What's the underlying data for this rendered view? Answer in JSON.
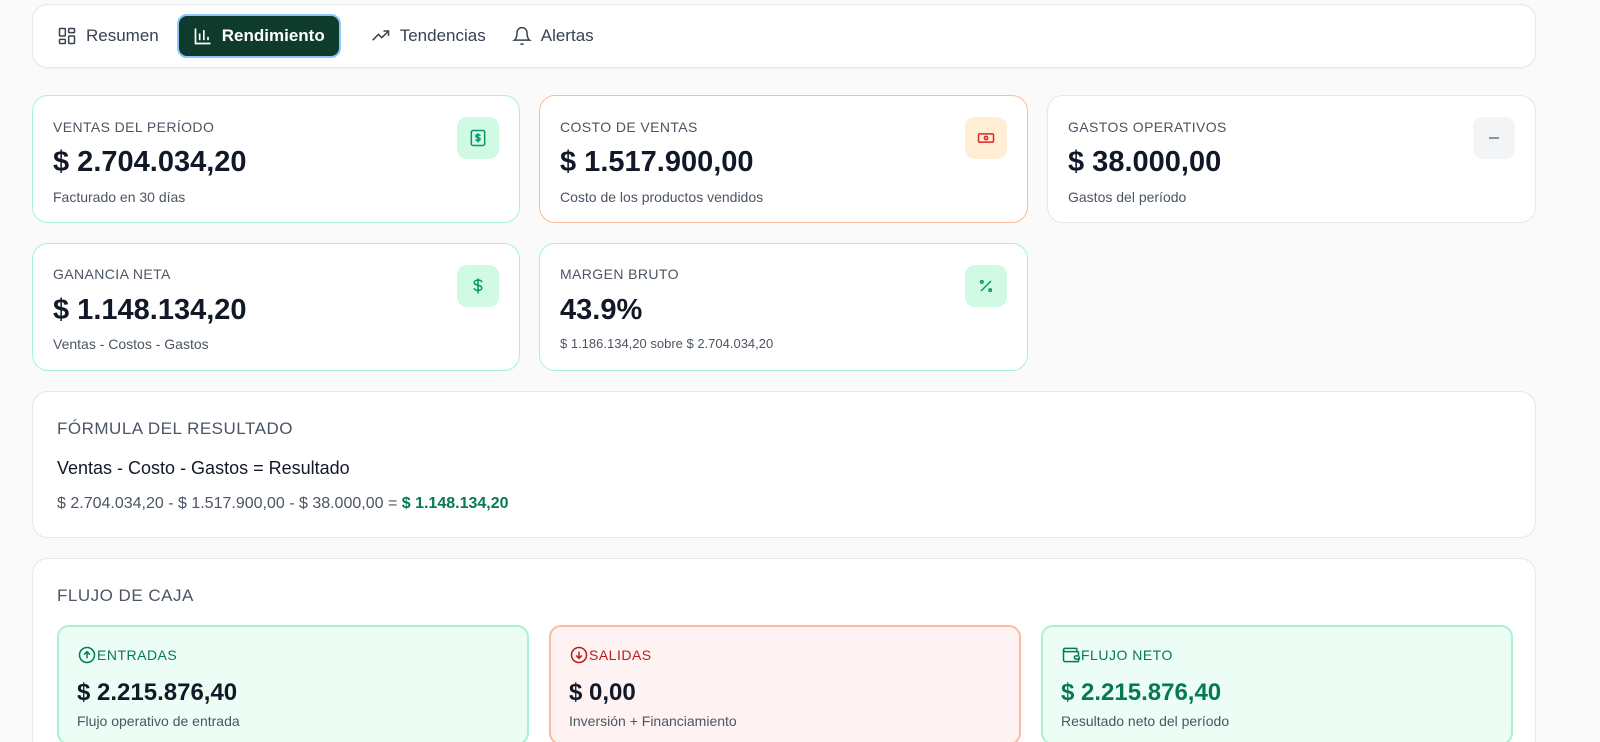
{
  "tabs": [
    {
      "label": "Resumen",
      "icon": "grid-icon"
    },
    {
      "label": "Rendimiento",
      "icon": "bar-chart-icon",
      "active": true
    },
    {
      "label": "Tendencias",
      "icon": "trending-up-icon"
    },
    {
      "label": "Alertas",
      "icon": "bell-icon"
    }
  ],
  "kpis": {
    "ventas": {
      "label": "VENTAS DEL PERÍODO",
      "value": "$ 2.704.034,20",
      "sub": "Facturado en 30 días",
      "icon": "receipt-dollar-icon"
    },
    "costo": {
      "label": "COSTO DE VENTAS",
      "value": "$ 1.517.900,00",
      "sub": "Costo de los productos vendidos",
      "icon": "banknote-icon"
    },
    "gastos": {
      "label": "GASTOS OPERATIVOS",
      "value": "$ 38.000,00",
      "sub": "Gastos del período",
      "icon": "minus-icon"
    },
    "ganancia": {
      "label": "GANANCIA NETA",
      "value": "$ 1.148.134,20",
      "sub": "Ventas - Costos - Gastos",
      "icon": "dollar-icon"
    },
    "margen": {
      "label": "MARGEN BRUTO",
      "value": "43.9%",
      "sub": "$ 1.186.134,20 sobre $ 2.704.034,20",
      "icon": "percent-icon"
    }
  },
  "formula": {
    "title": "FÓRMULA DEL RESULTADO",
    "heading": "Ventas - Costo - Gastos = Resultado",
    "expression": "$ 2.704.034,20 - $ 1.517.900,00 - $ 38.000,00 = ",
    "result": "$ 1.148.134,20"
  },
  "cashflow": {
    "title": "FLUJO DE CAJA",
    "entradas": {
      "label": "ENTRADAS",
      "value": "$ 2.215.876,40",
      "sub": "Flujo operativo de entrada"
    },
    "salidas": {
      "label": "SALIDAS",
      "value": "$ 0,00",
      "sub": "Inversión + Financiamiento"
    },
    "neto": {
      "label": "FLUJO NETO",
      "value": "$ 2.215.876,40",
      "sub": "Resultado neto del período"
    }
  },
  "colors": {
    "active_tab": "#0f3b2c",
    "positive": "#047857",
    "negative": "#b91c1c"
  }
}
